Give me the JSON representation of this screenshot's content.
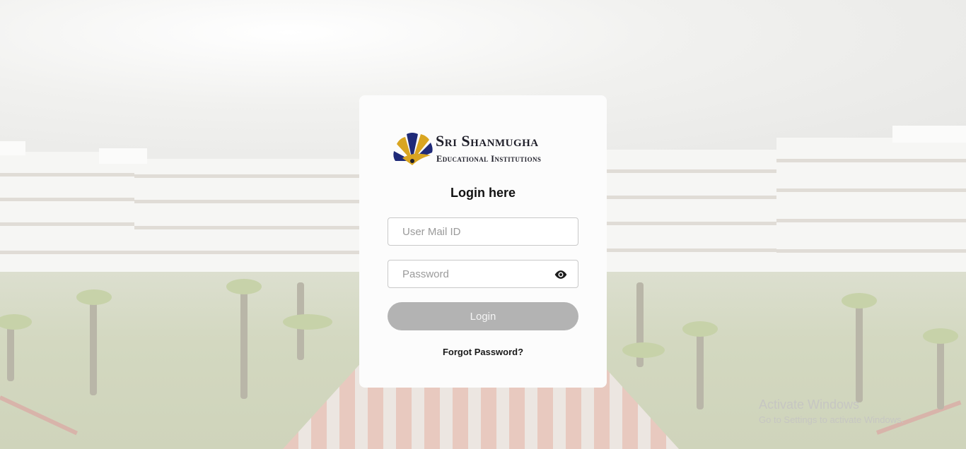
{
  "logo": {
    "line1": "Sri Shanmugha",
    "line2": "Educational Institutions"
  },
  "login": {
    "title": "Login here",
    "email_placeholder": "User Mail ID",
    "password_placeholder": "Password",
    "password_toggle_icon": "eye-icon",
    "submit_label": "Login",
    "forgot_label": "Forgot Password?"
  },
  "watermark": {
    "title": "Activate Windows",
    "subtitle": "Go to Settings to activate Windows."
  },
  "colors": {
    "button_disabled": "#b3b3b3",
    "card_background": "#fcfcfc"
  }
}
